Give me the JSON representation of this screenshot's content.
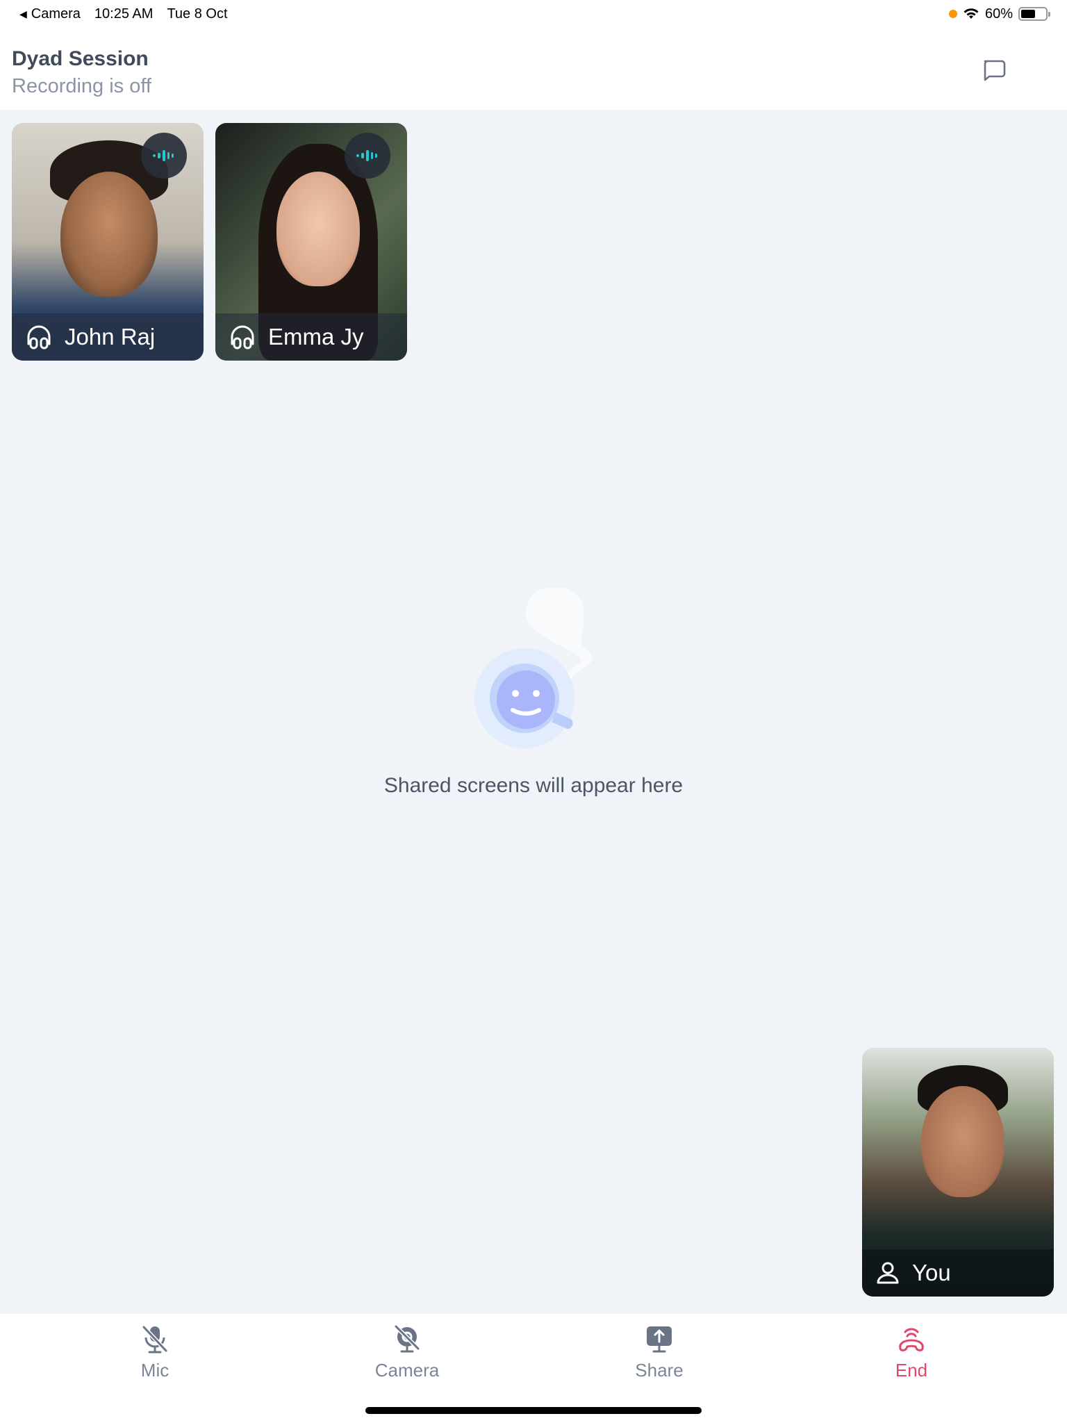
{
  "status_bar": {
    "back_app": "Camera",
    "time": "10:25 AM",
    "date": "Tue 8 Oct",
    "battery_percent": "60%",
    "battery_level": 0.6,
    "indicator_color": "#ff9500"
  },
  "header": {
    "title": "Dyad Session",
    "subtitle": "Recording is off",
    "chat_icon": "chat-bubble-icon"
  },
  "participants": [
    {
      "name": "John Raj",
      "audio_icon": "headphones-icon",
      "status_icon": "speaking-wave-icon"
    },
    {
      "name": "Emma Jy",
      "audio_icon": "headphones-icon",
      "status_icon": "speaking-wave-icon"
    }
  ],
  "self_view": {
    "name": "You",
    "icon": "person-icon"
  },
  "empty_state": {
    "message": "Shared screens will appear here",
    "illustration": "smiley-cup-icon"
  },
  "toolbar": {
    "items": [
      {
        "label": "Mic",
        "icon": "mic-off-icon",
        "state": "off"
      },
      {
        "label": "Camera",
        "icon": "camera-off-icon",
        "state": "off"
      },
      {
        "label": "Share",
        "icon": "share-screen-icon"
      },
      {
        "label": "End",
        "icon": "end-call-icon"
      }
    ]
  },
  "colors": {
    "accent_speaking": "#2bc5cc",
    "end_call": "#e0476b",
    "icon_gray": "#6b7486",
    "background": "#f0f4f8"
  }
}
